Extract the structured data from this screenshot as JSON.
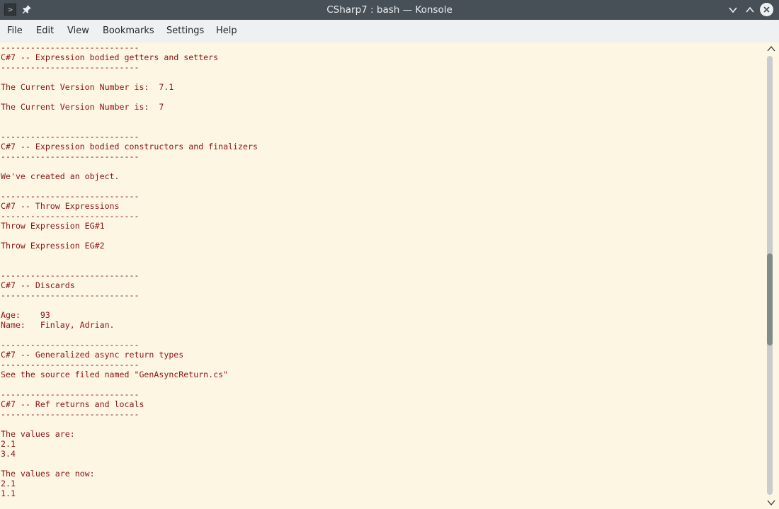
{
  "window": {
    "title": "CSharp7 : bash — Konsole",
    "icons": {
      "app": "terminal-icon",
      "pin": "pin-icon",
      "minimize": "chevron-down-icon",
      "maximize": "chevron-up-icon",
      "close": "close-icon"
    },
    "colors": {
      "titlebar": "#475057",
      "menubar": "#eff0f1",
      "terminal_bg": "#fdf6e3",
      "terminal_fg": "#8b1515"
    }
  },
  "menubar": {
    "items": [
      {
        "label": "File"
      },
      {
        "label": "Edit"
      },
      {
        "label": "View"
      },
      {
        "label": "Bookmarks"
      },
      {
        "label": "Settings"
      },
      {
        "label": "Help"
      }
    ]
  },
  "terminal": {
    "lines": [
      "----------------------------",
      "C#7 -- Expression bodied getters and setters",
      "----------------------------",
      "",
      "The Current Version Number is:  7.1",
      "",
      "The Current Version Number is:  7",
      "",
      "",
      "----------------------------",
      "C#7 -- Expression bodied constructors and finalizers",
      "----------------------------",
      "",
      "We've created an object.",
      "",
      "----------------------------",
      "C#7 -- Throw Expressions",
      "----------------------------",
      "Throw Expression EG#1",
      "",
      "Throw Expression EG#2",
      "",
      "",
      "----------------------------",
      "C#7 -- Discards",
      "----------------------------",
      "",
      "Age:    93",
      "Name:   Finlay, Adrian.",
      "",
      "----------------------------",
      "C#7 -- Generalized async return types",
      "----------------------------",
      "See the source filed named \"GenAsyncReturn.cs\"",
      "",
      "----------------------------",
      "C#7 -- Ref returns and locals",
      "----------------------------",
      "",
      "The values are:",
      "2.1",
      "3.4",
      "",
      "The values are now:",
      "2.1",
      "1.1",
      ""
    ]
  },
  "scrollbar": {
    "position_fraction": 0.57,
    "visible_fraction": 0.21
  }
}
